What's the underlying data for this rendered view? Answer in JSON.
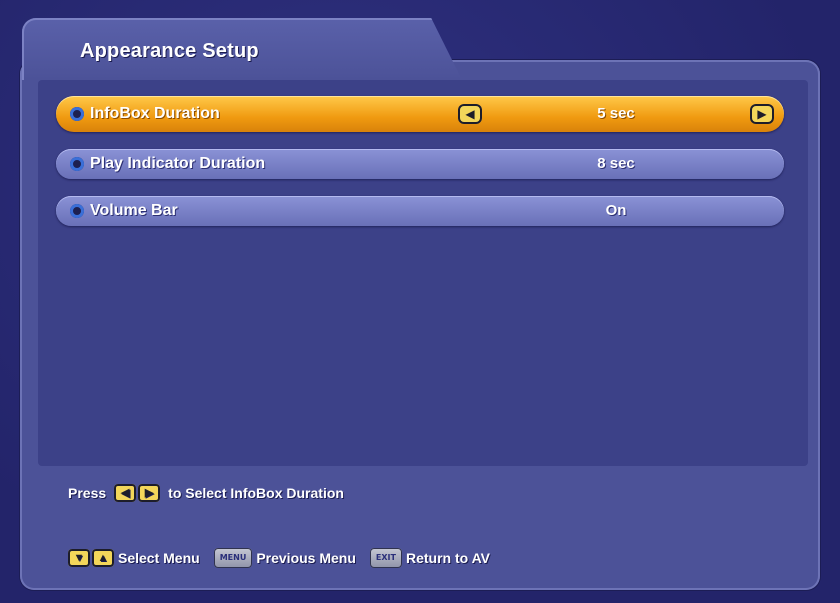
{
  "window": {
    "title": "Appearance Setup"
  },
  "settings": [
    {
      "label": "InfoBox Duration",
      "value": "5 sec",
      "selected": true
    },
    {
      "label": "Play Indicator Duration",
      "value": "8 sec",
      "selected": false
    },
    {
      "label": "Volume Bar",
      "value": "On",
      "selected": false
    }
  ],
  "hint": {
    "prefix": "Press",
    "suffix": "to Select InfoBox Duration"
  },
  "footer": {
    "select_menu": "Select Menu",
    "menu_key": "MENU",
    "previous_menu": "Previous Menu",
    "exit_key": "EXIT",
    "return_av": "Return to AV"
  },
  "icons": {
    "left_arrow": "◀",
    "right_arrow": "▶",
    "down_arrow": "▼",
    "up_arrow": "▲"
  },
  "colors": {
    "selected_row": "#f09a10",
    "normal_row": "#7a82c8",
    "key_yellow": "#f3d65a"
  }
}
